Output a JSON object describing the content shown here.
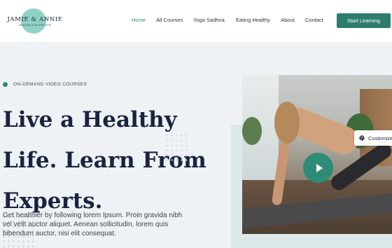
{
  "brand": {
    "name": "JAMIE & ANNIE",
    "subtitle": "HEALTH & NUTRITION"
  },
  "nav": {
    "items": [
      {
        "label": "Home",
        "active": true
      },
      {
        "label": "All Courses",
        "active": false
      },
      {
        "label": "Yoga Sadhna",
        "active": false
      },
      {
        "label": "Eating Healthy",
        "active": false
      },
      {
        "label": "About",
        "active": false
      },
      {
        "label": "Contact",
        "active": false
      }
    ],
    "cta_label": "Start Learning"
  },
  "hero": {
    "eyebrow": "ON-DEMAND VIDEO COURSES",
    "title_lines": [
      "Live a Healthy",
      "Life. Learn From",
      "Experts."
    ],
    "description_lines": [
      "Get healthier by following lorem Ipsum. Proin gravida nibh",
      "vel velit auctor aliquet. Aenean sollicitudin, lorem quis",
      "bibendum auctor, nisi elit consequat."
    ]
  },
  "video": {
    "play_icon": "play-icon"
  },
  "customize": {
    "label": "Customize",
    "icon": "palette-icon"
  },
  "colors": {
    "accent": "#2e8b78",
    "button": "#2e7d6e",
    "heading": "#1a2340",
    "logo_circle": "#8fd3c7"
  }
}
